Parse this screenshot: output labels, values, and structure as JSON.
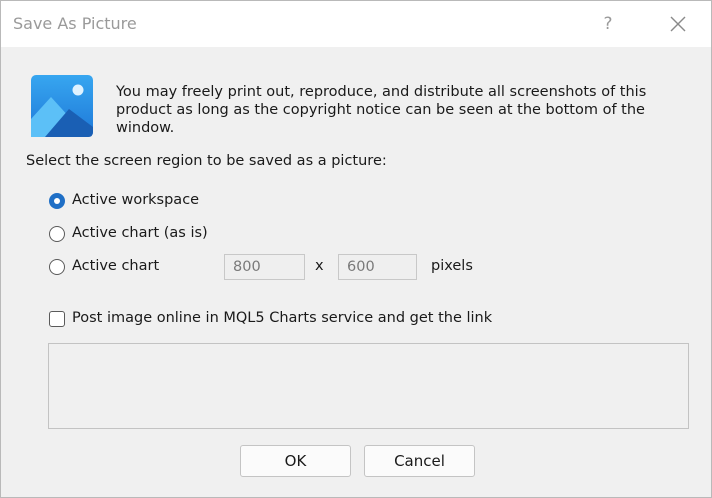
{
  "window": {
    "title": "Save As Picture",
    "help_label": "?"
  },
  "notice": "You may freely print out, reproduce, and distribute all screenshots of this product as long as the copyright notice can be seen at the bottom of the window.",
  "region_prompt": "Select the screen region to be saved as a picture:",
  "options": [
    {
      "label": "Active workspace",
      "checked": true
    },
    {
      "label": "Active chart (as is)",
      "checked": false
    },
    {
      "label": "Active chart",
      "checked": false
    }
  ],
  "size": {
    "width": "800",
    "separator": "x",
    "height": "600",
    "unit": "pixels"
  },
  "post_online": {
    "label": "Post image online in MQL5 Charts service and get the link",
    "checked": false
  },
  "link_value": "",
  "buttons": {
    "ok": "OK",
    "cancel": "Cancel"
  },
  "colors": {
    "accent": "#1f6fc6",
    "icon_bg": "#2f8fe0",
    "icon_dark": "#1c63b7"
  },
  "icons": [
    "picture-icon",
    "close-icon"
  ]
}
